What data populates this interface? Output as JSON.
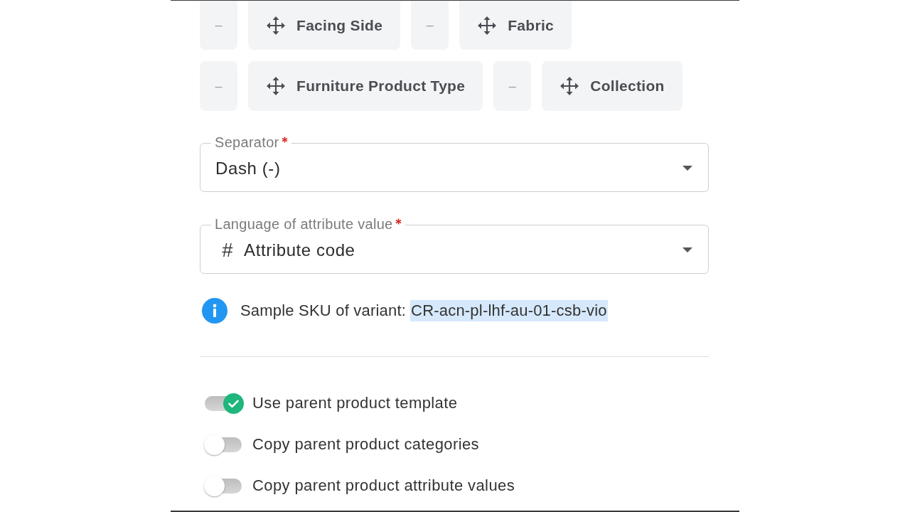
{
  "chip_rows": [
    [
      {
        "kind": "separator",
        "label": "–"
      },
      {
        "kind": "attribute",
        "label": "Facing Side"
      },
      {
        "kind": "separator",
        "label": "–"
      },
      {
        "kind": "attribute",
        "label": "Fabric"
      }
    ],
    [
      {
        "kind": "separator",
        "label": "–"
      },
      {
        "kind": "attribute",
        "label": "Furniture Product Type"
      },
      {
        "kind": "separator",
        "label": "–"
      },
      {
        "kind": "attribute",
        "label": "Collection"
      }
    ]
  ],
  "fields": [
    {
      "label": "Separator",
      "required": true,
      "value": "Dash (-)"
    },
    {
      "label": "Language of attribute value",
      "required": true,
      "prefix": "#",
      "value": "Attribute code"
    }
  ],
  "sample_sku": {
    "label": "Sample SKU of variant:",
    "value": "CR-acn-pl-lhf-au-01-csb-vio",
    "highlighted": true
  },
  "toggles": [
    {
      "label": "Use parent product template",
      "on": true
    },
    {
      "label": "Copy parent product categories",
      "on": false
    },
    {
      "label": "Copy parent product attribute values",
      "on": false
    }
  ]
}
